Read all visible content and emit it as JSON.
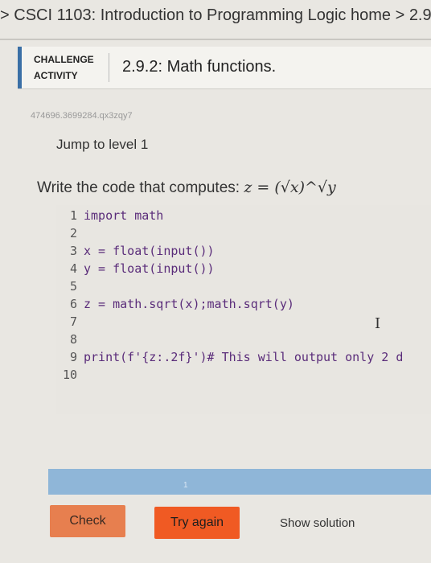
{
  "breadcrumb": {
    "prefix": "> ",
    "course": "CSCI 1103: Introduction to Programming Logic home",
    "separator": " > ",
    "current": "2.9:"
  },
  "challenge": {
    "label_line1": "CHALLENGE",
    "label_line2": "ACTIVITY",
    "title": "2.9.2: Math functions."
  },
  "activity_id": "474696.3699284.qx3zqy7",
  "jump_level": "Jump to level 1",
  "prompt": {
    "text": "Write the code that computes: ",
    "formula": "z = (√x)^√y"
  },
  "code": {
    "lines": [
      {
        "num": "1",
        "text": "import math"
      },
      {
        "num": "2",
        "text": ""
      },
      {
        "num": "3",
        "text": "x = float(input())"
      },
      {
        "num": "4",
        "text": "y = float(input())"
      },
      {
        "num": "5",
        "text": ""
      },
      {
        "num": "6",
        "text": "z = math.sqrt(x);math.sqrt(y)"
      },
      {
        "num": "7",
        "text": ""
      },
      {
        "num": "8",
        "text": ""
      },
      {
        "num": "9",
        "text": "print(f'{z:.2f}')# This will output only 2 d"
      },
      {
        "num": "10",
        "text": ""
      }
    ]
  },
  "progress": {
    "level_text": "1",
    "fraction": 0.0
  },
  "buttons": {
    "check": "Check",
    "try_again": "Try again",
    "show_solution": "Show solution"
  },
  "colors": {
    "check_button": "#e77f4f",
    "try_again_button": "#f05a23",
    "progress_bar": "#8fb6d8",
    "activity_bar": "#3a6fa6"
  }
}
